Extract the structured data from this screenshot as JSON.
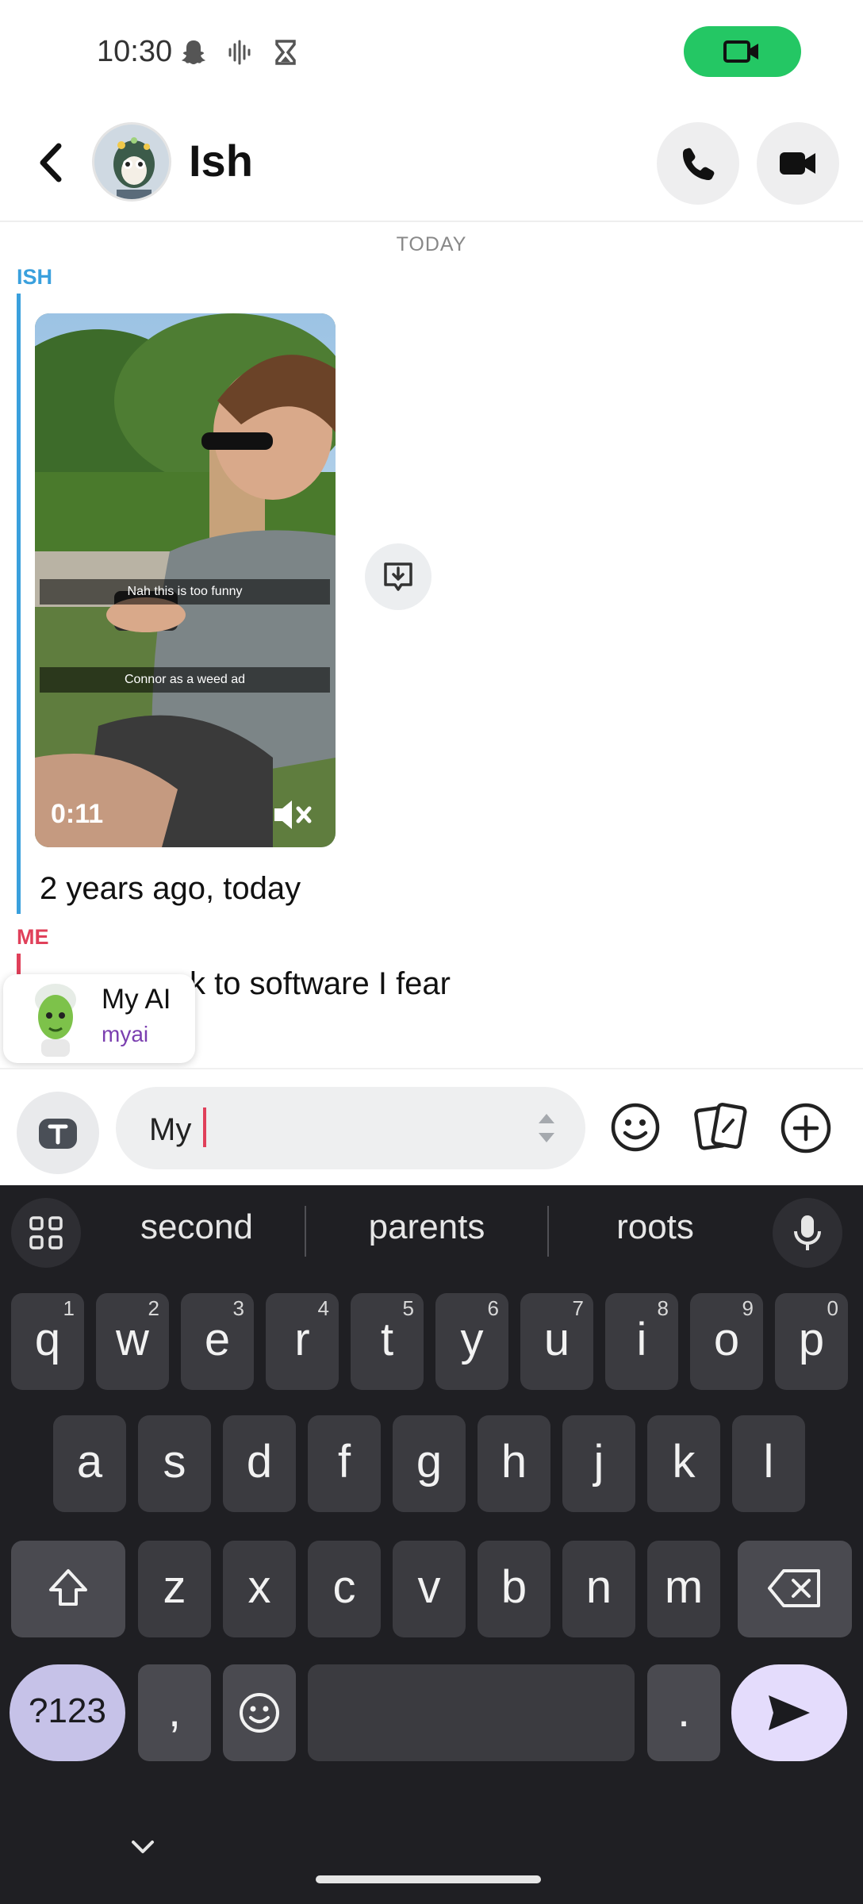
{
  "status_bar": {
    "time": "10:30",
    "icons": [
      "snapchat-ghost-icon",
      "voice-wave-icon",
      "hourglass-icon"
    ],
    "video_pill_icon": "video-camera-icon",
    "video_pill_color": "#24c764"
  },
  "header": {
    "contact_name": "Ish",
    "back_icon": "chevron-left-icon",
    "call_icon": "phone-icon",
    "video_icon": "video-camera-icon"
  },
  "chat": {
    "date_separator": "TODAY",
    "messages": [
      {
        "sender": "ISH",
        "sender_color": "#3aa0dd",
        "video": {
          "captions": [
            "Nah this is too funny",
            "Connor as a weed ad"
          ],
          "duration": "0:11",
          "muted_icon": "speaker-muted-icon"
        },
        "save_icon": "save-to-chat-icon",
        "text": "2 years ago, today"
      },
      {
        "sender": "ME",
        "sender_color": "#e0405a",
        "text": "ck to software I fear"
      }
    ],
    "mention_suggestion": {
      "name": "My AI",
      "username": "myai"
    }
  },
  "composer": {
    "camera_icon": "text-camera-icon",
    "input_value": "My",
    "icons": [
      "emoji-face-icon",
      "sticker-cards-icon",
      "plus-circle-icon"
    ]
  },
  "keyboard": {
    "suggestions": [
      "second",
      "parents",
      "roots"
    ],
    "row1": [
      {
        "key": "q",
        "hint": "1"
      },
      {
        "key": "w",
        "hint": "2"
      },
      {
        "key": "e",
        "hint": "3"
      },
      {
        "key": "r",
        "hint": "4"
      },
      {
        "key": "t",
        "hint": "5"
      },
      {
        "key": "y",
        "hint": "6"
      },
      {
        "key": "u",
        "hint": "7"
      },
      {
        "key": "i",
        "hint": "8"
      },
      {
        "key": "o",
        "hint": "9"
      },
      {
        "key": "p",
        "hint": "0"
      }
    ],
    "row2": [
      "a",
      "s",
      "d",
      "f",
      "g",
      "h",
      "j",
      "k",
      "l"
    ],
    "row3": [
      "z",
      "x",
      "c",
      "v",
      "b",
      "n",
      "m"
    ],
    "symbols_label": "?123",
    "comma": ",",
    "period": ".",
    "accent_color": "#c6c2e8"
  }
}
